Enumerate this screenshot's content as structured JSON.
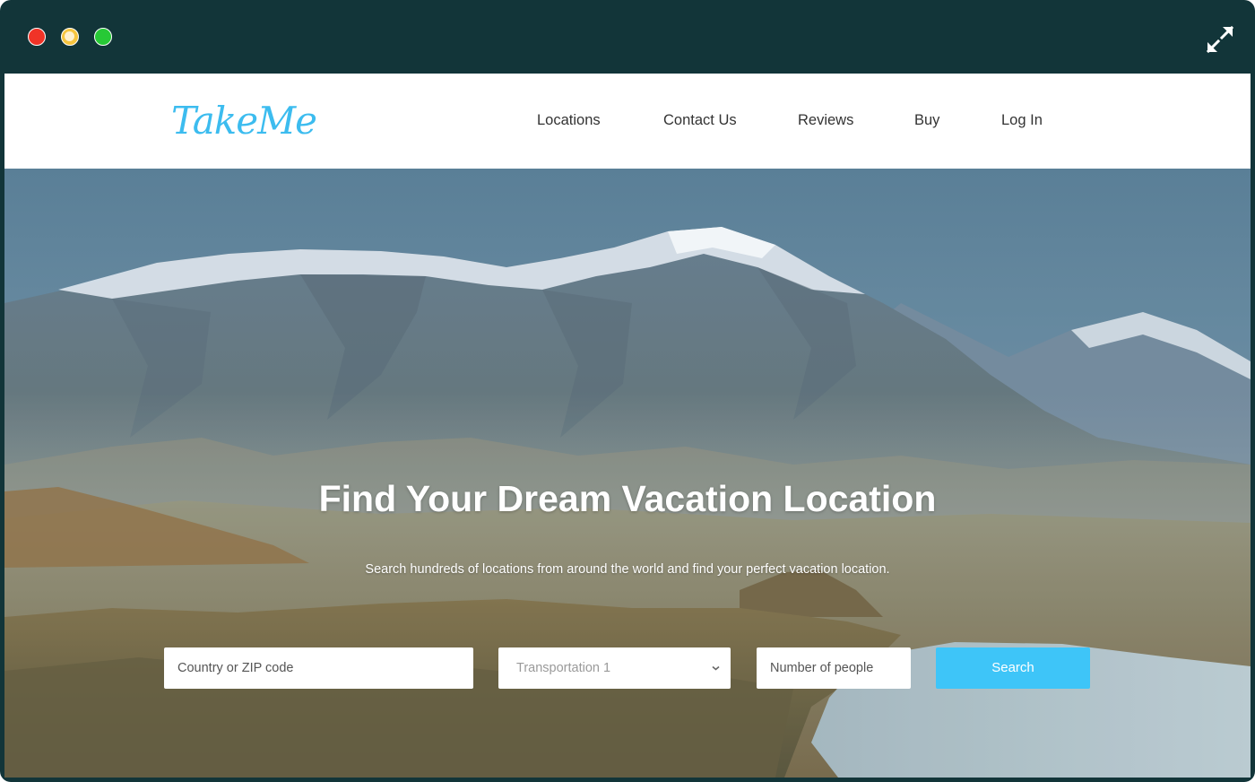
{
  "window": {
    "controls": [
      "close-button",
      "minimize-button",
      "zoom-button"
    ],
    "expand_icon": "expand-arrows-icon"
  },
  "navbar": {
    "logo": "TakeMe",
    "links": [
      "Locations",
      "Contact Us",
      "Reviews",
      "Buy",
      "Log In"
    ]
  },
  "hero": {
    "title": "Find Your Dream Vacation Location",
    "subtitle": "Search hundreds of locations from around the world and find your perfect vacation location.",
    "background": "mountain-lake-landscape"
  },
  "search_form": {
    "location_placeholder": "Country or ZIP code",
    "transportation_selected": "Transportation 1",
    "people_placeholder": "Number of people",
    "search_label": "Search"
  },
  "colors": {
    "frame": "#123539",
    "brand": "#3cbcef",
    "button": "#3ec5f8"
  }
}
